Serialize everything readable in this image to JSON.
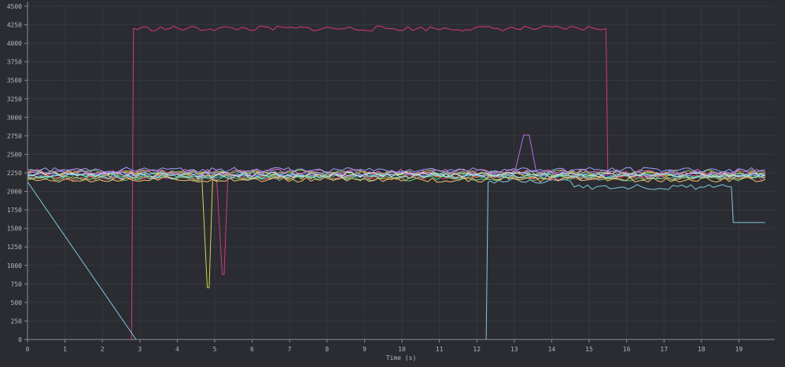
{
  "chart_data": {
    "type": "line",
    "title": "",
    "xlabel": "Time (s)",
    "ylabel": "",
    "xlim": [
      0,
      19.8
    ],
    "ylim": [
      0,
      4500
    ],
    "grid": true,
    "legend": "none",
    "x_ticks": [
      0,
      1,
      2,
      3,
      4,
      5,
      6,
      7,
      8,
      9,
      10,
      11,
      12,
      13,
      14,
      15,
      16,
      17,
      18,
      19
    ],
    "y_ticks": [
      0,
      250,
      500,
      750,
      1000,
      1250,
      1500,
      1750,
      2000,
      2250,
      2500,
      2750,
      3000,
      3250,
      3500,
      3750,
      4000,
      4250,
      4500
    ],
    "series": [
      {
        "color": "#d4387f",
        "x": [
          0,
          2.78,
          2.83,
          15.45,
          15.5,
          19.7
        ],
        "y": [
          0,
          0,
          4200,
          4200,
          2200,
          2210
        ]
      },
      {
        "color": "#7fc8e0",
        "x": [
          0,
          2.9,
          12.25,
          12.3,
          12.35,
          14.5,
          14.6,
          18.8,
          18.85,
          18.9,
          19.7
        ],
        "y": [
          2130,
          0,
          0,
          2120,
          2140,
          2140,
          2060,
          2060,
          1580,
          1580,
          1580
        ]
      },
      {
        "color": "#d6d64a",
        "x": [
          0,
          4.65,
          4.8,
          4.85,
          4.95,
          19.7
        ],
        "y": [
          2250,
          2260,
          700,
          700,
          2240,
          2240
        ]
      },
      {
        "color": "#d4387f",
        "x": [
          0,
          5.05,
          5.2,
          5.25,
          5.35,
          19.7
        ],
        "y": [
          2180,
          2180,
          880,
          880,
          2190,
          2190
        ]
      },
      {
        "color": "#b56ee6",
        "x": [
          0,
          13.0,
          13.25,
          13.4,
          13.6,
          19.7
        ],
        "y": [
          2230,
          2230,
          2760,
          2760,
          2230,
          2230
        ]
      },
      {
        "color": "#9acd32",
        "x": [
          0,
          19.7
        ],
        "y": [
          2255,
          2255
        ]
      },
      {
        "color": "#45d0c0",
        "x": [
          0,
          19.7
        ],
        "y": [
          2210,
          2210
        ]
      },
      {
        "color": "#e69a4a",
        "x": [
          0,
          19.7
        ],
        "y": [
          2195,
          2195
        ]
      },
      {
        "color": "#6f8fe6",
        "x": [
          0,
          19.7
        ],
        "y": [
          2240,
          2240
        ]
      },
      {
        "color": "#e6e6e6",
        "x": [
          0,
          19.7
        ],
        "y": [
          2225,
          2225
        ]
      },
      {
        "color": "#5ecf7a",
        "x": [
          0,
          19.7
        ],
        "y": [
          2175,
          2175
        ]
      },
      {
        "color": "#e66bb8",
        "x": [
          0,
          19.7
        ],
        "y": [
          2265,
          2265
        ]
      },
      {
        "color": "#a0a0ff",
        "x": [
          0,
          19.7
        ],
        "y": [
          2290,
          2290
        ]
      },
      {
        "color": "#f0c36a",
        "x": [
          0,
          19.7
        ],
        "y": [
          2160,
          2160
        ]
      },
      {
        "color": "#8ee6e6",
        "x": [
          0,
          19.7
        ],
        "y": [
          2205,
          2205
        ]
      }
    ]
  }
}
